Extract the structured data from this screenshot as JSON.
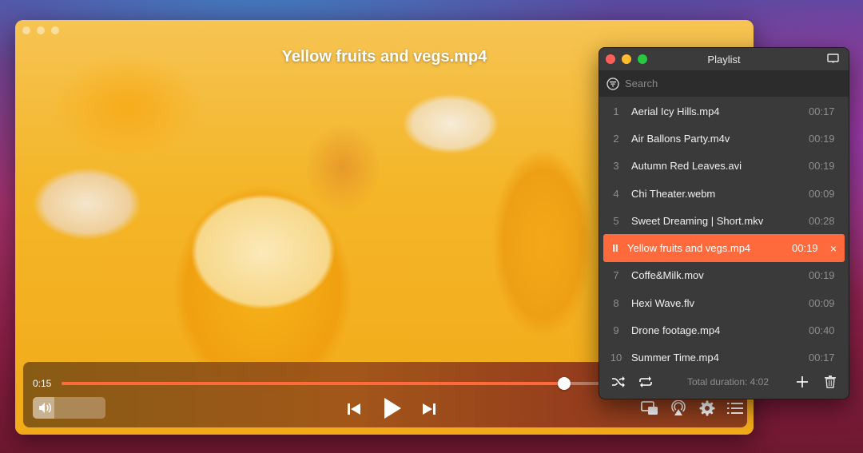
{
  "player": {
    "title": "Yellow fruits and vegs.mp4",
    "current_time": "0:15",
    "progress_fraction": 0.74,
    "volume_fraction": 0.3,
    "controls": {
      "previous": "skip-previous",
      "play": "play",
      "next": "skip-next",
      "picture_in_picture": "picture-in-picture",
      "airplay": "airplay",
      "settings": "settings",
      "playlist": "playlist"
    }
  },
  "playlist": {
    "title": "Playlist",
    "search_placeholder": "Search",
    "active_index": 5,
    "items": [
      {
        "num": "1",
        "name": "Aerial Icy Hills.mp4",
        "duration": "00:17"
      },
      {
        "num": "2",
        "name": "Air Ballons Party.m4v",
        "duration": "00:19"
      },
      {
        "num": "3",
        "name": "Autumn Red Leaves.avi",
        "duration": "00:19"
      },
      {
        "num": "4",
        "name": "Chi Theater.webm",
        "duration": "00:09"
      },
      {
        "num": "5",
        "name": "Sweet Dreaming | Short.mkv",
        "duration": "00:28"
      },
      {
        "num": "II",
        "name": "Yellow fruits and vegs.mp4",
        "duration": "00:19",
        "remove": "×"
      },
      {
        "num": "7",
        "name": "Coffe&Milk.mov",
        "duration": "00:19"
      },
      {
        "num": "8",
        "name": "Hexi Wave.flv",
        "duration": "00:09"
      },
      {
        "num": "9",
        "name": "Drone footage.mp4",
        "duration": "00:40"
      },
      {
        "num": "10",
        "name": "Summer Time.mp4",
        "duration": "00:17"
      }
    ],
    "total_duration": "Total duration: 4:02"
  },
  "colors": {
    "accent": "#ff6a3d",
    "traffic_red": "#ff5f57",
    "traffic_yellow": "#febc2e",
    "traffic_green": "#28c840",
    "playlist_bg": "#3a3a3b"
  }
}
